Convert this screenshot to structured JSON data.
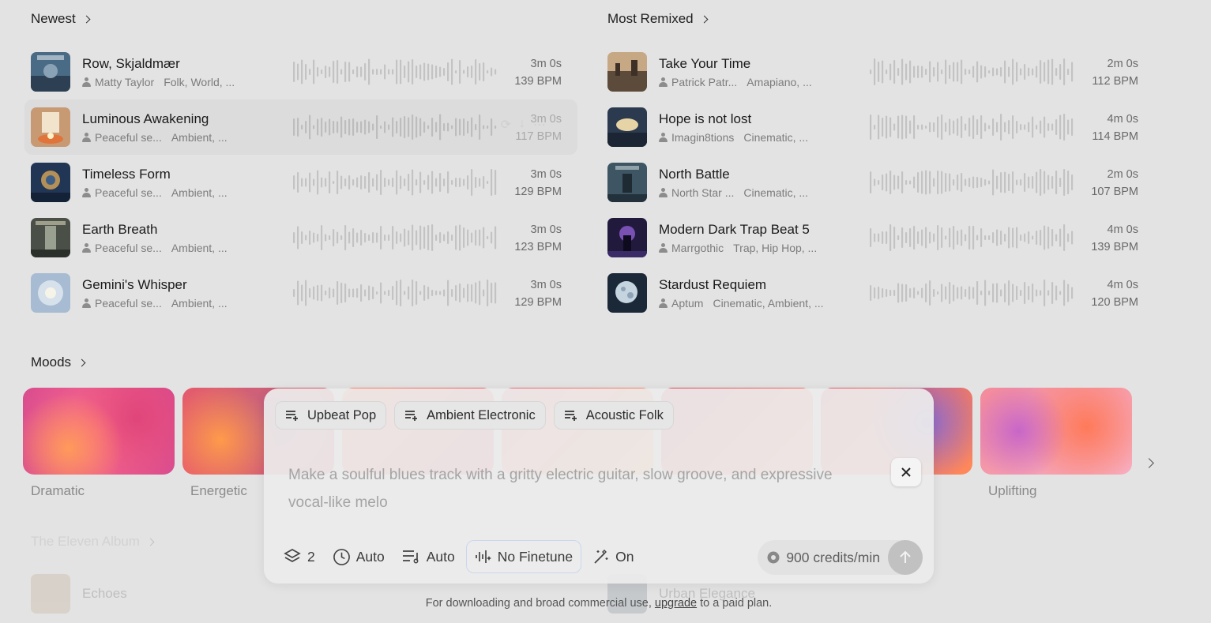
{
  "newest": {
    "heading": "Newest",
    "tracks": [
      {
        "title": "Row, Skjaldmær",
        "artist": "Matty Taylor",
        "genres": "Folk, World, ...",
        "duration": "3m 0s",
        "bpm": "139 BPM"
      },
      {
        "title": "Luminous Awakening",
        "artist": "Peaceful se...",
        "genres": "Ambient, ...",
        "duration": "3m 0s",
        "bpm": "117 BPM"
      },
      {
        "title": "Timeless Form",
        "artist": "Peaceful se...",
        "genres": "Ambient, ...",
        "duration": "3m 0s",
        "bpm": "129 BPM"
      },
      {
        "title": "Earth Breath",
        "artist": "Peaceful se...",
        "genres": "Ambient, ...",
        "duration": "3m 0s",
        "bpm": "123 BPM"
      },
      {
        "title": "Gemini's Whisper",
        "artist": "Peaceful se...",
        "genres": "Ambient, ...",
        "duration": "3m 0s",
        "bpm": "129 BPM"
      }
    ]
  },
  "most_remixed": {
    "heading": "Most Remixed",
    "tracks": [
      {
        "title": "Take Your Time",
        "artist": "Patrick Patr...",
        "genres": "Amapiano, ...",
        "duration": "2m 0s",
        "bpm": "112 BPM"
      },
      {
        "title": "Hope is not lost",
        "artist": "Imagin8tions",
        "genres": "Cinematic, ...",
        "duration": "4m 0s",
        "bpm": "114 BPM"
      },
      {
        "title": "North Battle",
        "artist": "North Star ...",
        "genres": "Cinematic, ...",
        "duration": "2m 0s",
        "bpm": "107 BPM"
      },
      {
        "title": "Modern Dark Trap Beat 5",
        "artist": "Marrgothic",
        "genres": "Trap, Hip Hop, ...",
        "duration": "4m 0s",
        "bpm": "139 BPM"
      },
      {
        "title": "Stardust Requiem",
        "artist": "Aptum",
        "genres": "Cinematic, Ambient, ...",
        "duration": "4m 0s",
        "bpm": "120 BPM"
      }
    ]
  },
  "moods": {
    "heading": "Moods",
    "items": [
      "Dramatic",
      "Energetic",
      "Uplifting"
    ]
  },
  "album": {
    "heading": "The Eleven Album",
    "left_track": "Echoes",
    "right_track": "Urban Elegance"
  },
  "composer": {
    "chips": [
      "Upbeat Pop",
      "Ambient Electronic",
      "Acoustic Folk"
    ],
    "prompt": "Make a soulful blues track with a gritty electric guitar, slow groove, and expressive vocal-like melo",
    "variations": "2",
    "duration": "Auto",
    "structure": "Auto",
    "finetune": "No Finetune",
    "enhance": "On",
    "credits": "900 credits/min"
  },
  "footer": {
    "before": "For downloading and broad commercial use,",
    "link": "upgrade",
    "after": "to a paid plan."
  }
}
